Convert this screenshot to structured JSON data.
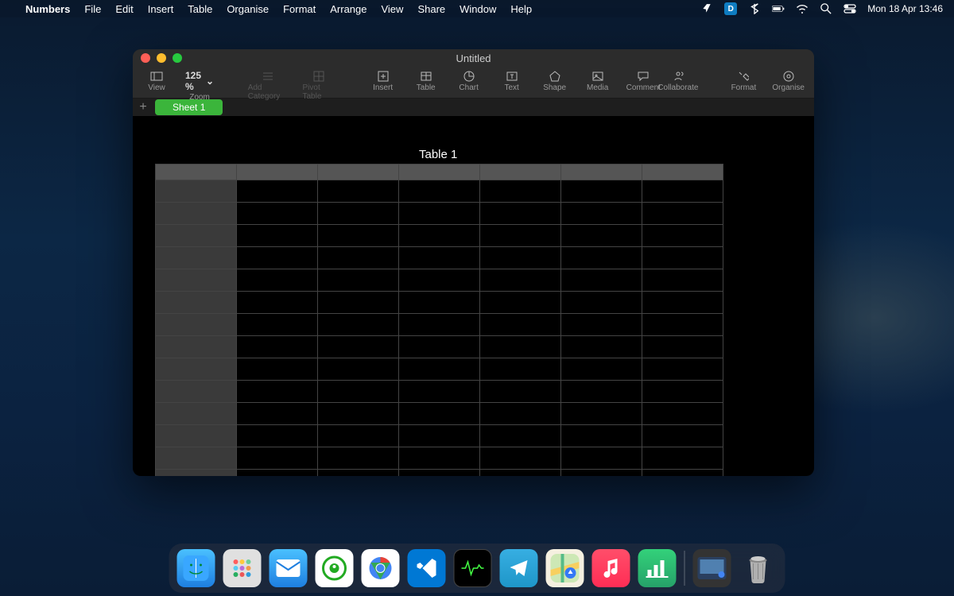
{
  "menubar": {
    "apple": "",
    "app": "Numbers",
    "items": [
      "File",
      "Edit",
      "Insert",
      "Table",
      "Organise",
      "Format",
      "Arrange",
      "View",
      "Share",
      "Window",
      "Help"
    ],
    "clock": "Mon 18 Apr  13:46"
  },
  "window": {
    "title": "Untitled",
    "toolbar": {
      "view": "View",
      "zoom_value": "125 %",
      "zoom_label": "Zoom",
      "add_category": "Add Category",
      "pivot_table": "Pivot Table",
      "insert": "Insert",
      "table": "Table",
      "chart": "Chart",
      "text": "Text",
      "shape": "Shape",
      "media": "Media",
      "comment": "Comment",
      "collaborate": "Collaborate",
      "format": "Format",
      "organise": "Organise"
    },
    "sheet_tab": "Sheet 1",
    "table_name": "Table 1",
    "table": {
      "columns": 7,
      "rows": 14,
      "cells": []
    }
  },
  "dock": {
    "items": [
      "finder",
      "launchpad",
      "mail",
      "keychain",
      "chrome",
      "vscode",
      "activity-monitor",
      "telegram",
      "maps",
      "music",
      "numbers",
      "desktop",
      "trash"
    ]
  }
}
